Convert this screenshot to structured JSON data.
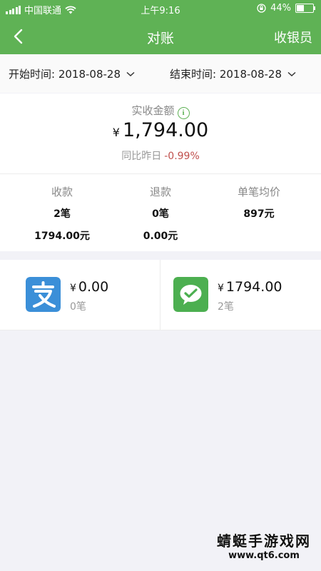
{
  "status_bar": {
    "carrier": "中国联通",
    "time": "上午9:16",
    "battery": "44%",
    "battery_level": 0.44
  },
  "nav": {
    "title": "对账",
    "right_label": "收银员"
  },
  "date_filter": {
    "start_label": "开始时间: 2018-08-28",
    "end_label": "结束时间: 2018-08-28"
  },
  "summary": {
    "label": "实收金额",
    "info_glyph": "i",
    "currency": "¥",
    "amount": "1,794.00",
    "compare_label": "同比昨日",
    "compare_value": "-0.99%"
  },
  "stats": [
    {
      "header": "收款",
      "value1": "2笔",
      "value2": "1794.00元"
    },
    {
      "header": "退款",
      "value1": "0笔",
      "value2": "0.00元"
    },
    {
      "header": "单笔均价",
      "value1": "897元",
      "value2": ""
    }
  ],
  "payments": {
    "alipay": {
      "icon": "alipay-icon",
      "currency": "¥",
      "amount": "0.00",
      "count": "0笔",
      "color": "#3b8fd8"
    },
    "wechat": {
      "icon": "wechat-pay-icon",
      "currency": "¥",
      "amount": "1794.00",
      "count": "2笔",
      "color": "#4caf50"
    }
  },
  "watermark": {
    "text": "蜻蜓手游戏网",
    "url": "www.qt6.com"
  },
  "colors": {
    "brand_green": "#5fb255",
    "negative_red": "#c0504d"
  }
}
